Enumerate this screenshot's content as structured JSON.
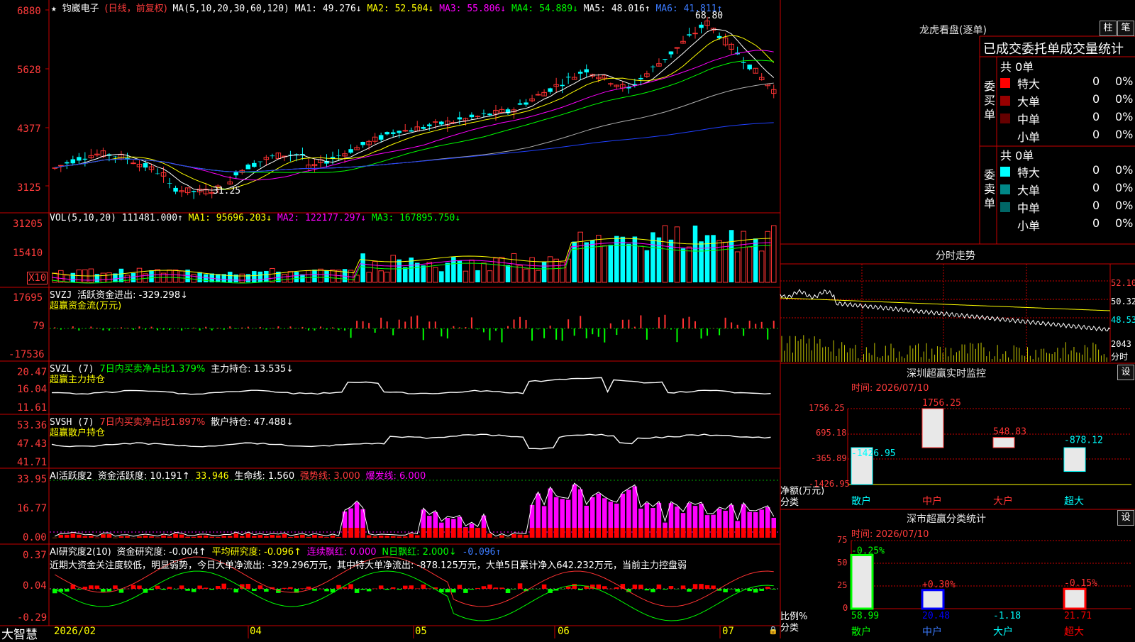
{
  "main_chart": {
    "header": {
      "stock": "钧崴电子",
      "mode": "(日线，前复权)",
      "ma_label": "MA(5,10,20,30,60,120)",
      "ma1": "MA1: 49.276↓",
      "ma2": "MA2: 52.504↓",
      "ma3": "MA3: 55.806↓",
      "ma4": "MA4: 54.889↓",
      "ma5": "MA5: 48.016↑",
      "ma6": "MA6: 41.811↑"
    },
    "y_ticks": [
      "6880",
      "5628",
      "4377",
      "3125"
    ],
    "high_label": "68.80",
    "low_label": "31.25"
  },
  "vol_panel": {
    "header": {
      "name": "VOL(5,10,20)",
      "v": "111481.000↑",
      "ma1": "MA1: 95696.203↓",
      "ma2": "MA2: 122177.297↓",
      "ma3": "MA3: 167895.750↓"
    },
    "y_ticks": [
      "31205",
      "15410",
      "X10"
    ]
  },
  "svzj_panel": {
    "header": {
      "name": "SVZJ",
      "desc": "活跃资金进出: -329.298↓",
      "sub": "超赢资金流(万元)"
    },
    "y_ticks": [
      "17695",
      "79",
      "-17536"
    ]
  },
  "svzl_panel": {
    "header": {
      "name": "SVZL (7)",
      "ratio": "7日内买卖净占比1.379%",
      "hold": "主力持仓: 13.535↓",
      "sub": "超赢主力持仓"
    },
    "y_ticks": [
      "20.47",
      "16.04",
      "11.61"
    ]
  },
  "svsh_panel": {
    "header": {
      "name": "SVSH (7)",
      "ratio": "7日内买卖净占比1.897%",
      "hold": "散户持仓: 47.488↓",
      "sub": "超赢散户持仓"
    },
    "y_ticks": [
      "53.36",
      "47.43",
      "41.71"
    ]
  },
  "ai_active_panel": {
    "header": {
      "name": "AI活跃度2",
      "a": "资金活跃度: 10.191↑",
      "b": "33.946",
      "c": "生命线: 1.560",
      "d": "强势线: 3.000",
      "e": "爆发线: 6.000"
    },
    "y_ticks": [
      "33.95",
      "16.77",
      "0.00"
    ]
  },
  "ai_research_panel": {
    "header": {
      "name": "AI研究度2(10)",
      "a": "资金研究度: -0.004↑",
      "b": "平均研究度: -0.096↑",
      "c": "连续飘红: 0.000",
      "d": "N日飘红: 2.000↓",
      "e": "-0.096↑"
    },
    "comment": "近期大资金关注度较低，明显弱势，今日大单净流出: -329.296万元，其中特大单净流出: -878.125万元，大单5日累计净入642.232万元，当前主力控盘弱",
    "y_ticks": [
      "0.37",
      "0.04",
      "-0.29"
    ]
  },
  "footer": {
    "brand": "大智慧",
    "dates": [
      "2026/02",
      "04",
      "05",
      "06",
      "07"
    ]
  },
  "right_panel": {
    "dragon_title": "龙虎看盘(逐单)",
    "btn_zhu": "柱",
    "btn_bi": "笔",
    "stats_title": "已成交委托单成交量统计",
    "buy_label": "委买单",
    "sell_label": "委卖单",
    "buy_total": "共 0单",
    "sell_total": "共 0单",
    "buy_rows": [
      {
        "name": "特大",
        "n": "0",
        "pct": "0%",
        "color": "#ff0000"
      },
      {
        "name": "大单",
        "n": "0",
        "pct": "0%",
        "color": "#990000"
      },
      {
        "name": "中单",
        "n": "0",
        "pct": "0%",
        "color": "#660000"
      },
      {
        "name": "小单",
        "n": "0",
        "pct": "0%",
        "color": ""
      }
    ],
    "sell_rows": [
      {
        "name": "特大",
        "n": "0",
        "pct": "0%",
        "color": "#00ffff"
      },
      {
        "name": "大单",
        "n": "0",
        "pct": "0%",
        "color": "#008888"
      },
      {
        "name": "中单",
        "n": "0",
        "pct": "0%",
        "color": "#006666"
      },
      {
        "name": "小单",
        "n": "0",
        "pct": "0%",
        "color": ""
      }
    ],
    "intraday_title": "分时走势",
    "intraday_y": [
      "52.10",
      "50.32",
      "48.53",
      "2043",
      "分时"
    ],
    "monitor_title": "深圳超赢实时监控",
    "monitor_btn": "设",
    "monitor_time": "时间: 2026/07/10",
    "monitor_y": [
      "1756.25",
      "695.18",
      "-365.89",
      "-1426.95"
    ],
    "monitor_ylabel": "净额(万元)",
    "monitor_xlabel": "分类",
    "classify_title": "深市超赢分类统计",
    "classify_btn": "设",
    "classify_time": "时间: 2026/07/10",
    "classify_y": [
      "75",
      "50",
      "25",
      "0"
    ],
    "classify_ylabel": "比例%",
    "classify_xlabel": "分类"
  },
  "chart_data": [
    {
      "type": "bar",
      "title": "深圳超赢实时监控",
      "categories": [
        "散户",
        "中户",
        "大户",
        "超大"
      ],
      "values": [
        -1426.95,
        1756.25,
        548.83,
        -878.12
      ],
      "ylim": [
        -1426.95,
        1756.25
      ],
      "ylabel": "净额(万元)",
      "xlabel": "分类"
    },
    {
      "type": "bar",
      "title": "深市超赢分类统计",
      "categories": [
        "散户",
        "中户",
        "大户",
        "超大"
      ],
      "values": [
        58.99,
        20.48,
        -1.18,
        21.71
      ],
      "annotations": [
        "-0.25%",
        "+0.30%",
        "",
        "-0.15%"
      ],
      "ylim": [
        0,
        75
      ],
      "ylabel": "比例%",
      "xlabel": "分类",
      "colors": [
        "#00ff00",
        "#0000ff",
        "#00ffff",
        "#ff0000"
      ]
    }
  ]
}
